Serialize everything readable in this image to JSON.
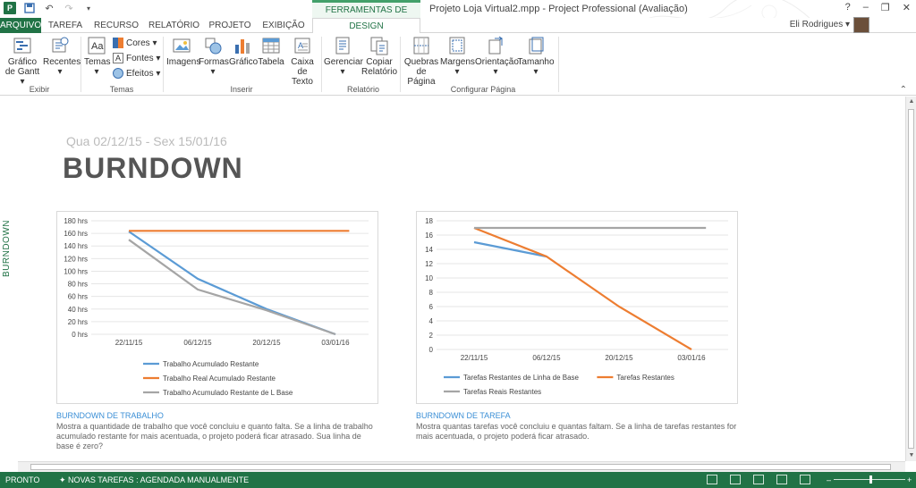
{
  "window": {
    "context_tab_header": "FERRAMENTAS DE RELATÓRIO",
    "title": "Projeto Loja Virtual2.mpp - Project Professional (Avaliação)",
    "help": "?",
    "minimize": "–",
    "restore": "❐",
    "close": "✕"
  },
  "tabs": [
    "ARQUIVO",
    "TAREFA",
    "RECURSO",
    "RELATÓRIO",
    "PROJETO",
    "EXIBIÇÃO",
    "DESIGN"
  ],
  "user": {
    "name": "Eli Rodrigues ▾"
  },
  "ribbon": {
    "groups": [
      "Exibir",
      "Temas",
      "Inserir",
      "Relatório",
      "Configurar Página"
    ],
    "buttons": {
      "gantt": "Gráfico de Gantt ▾",
      "recentes": "Recentes ▾",
      "temas": "Temas ▾",
      "cores": "Cores ▾",
      "fontes": "Fontes ▾",
      "efeitos": "Efeitos ▾",
      "imagens": "Imagens",
      "formas": "Formas ▾",
      "grafico": "Gráfico",
      "tabela": "Tabela",
      "caixa_texto": "Caixa de Texto",
      "gerenciar": "Gerenciar ▾",
      "copiar": "Copiar Relatório",
      "quebras": "Quebras de Página",
      "margens": "Margens ▾",
      "orientacao": "Orientação ▾",
      "tamanho": "Tamanho ▾"
    }
  },
  "report": {
    "side_label": "BURNDOWN",
    "date_range": "Qua 02/12/15 -  Sex 15/01/16",
    "title": "BURNDOWN"
  },
  "charts": {
    "work": {
      "caption": "BURNDOWN DE TRABALHO",
      "description": "Mostra a quantidade de trabalho que você concluiu e quanto falta. Se a linha de trabalho acumulado restante for mais acentuada, o projeto poderá ficar atrasado. Sua linha de base é zero?"
    },
    "tasks": {
      "caption": "BURNDOWN DE TAREFA",
      "description": "Mostra quantas tarefas você concluiu e quantas faltam. Se a linha de tarefas restantes for mais acentuada, o projeto poderá ficar atrasado."
    }
  },
  "chart_data": [
    {
      "type": "line",
      "x": [
        "22/11/15",
        "06/12/15",
        "20/12/15",
        "03/01/16"
      ],
      "ylim": [
        0,
        180
      ],
      "yticks": [
        "0 hrs",
        "20 hrs",
        "40 hrs",
        "60 hrs",
        "80 hrs",
        "100 hrs",
        "120 hrs",
        "140 hrs",
        "160 hrs",
        "180 hrs"
      ],
      "legend_position": "bottom",
      "series": [
        {
          "name": "Trabalho Acumulado Restante",
          "color": "#5b9bd5",
          "points": [
            [
              0,
              163
            ],
            [
              1,
              88
            ],
            [
              2,
              40
            ],
            [
              3,
              0
            ]
          ]
        },
        {
          "name": "Trabalho Real Acumulado Restante",
          "color": "#ed7d31",
          "points": [
            [
              0,
              164
            ],
            [
              3.2,
              164
            ]
          ]
        },
        {
          "name": "Trabalho Acumulado Restante de L Base",
          "color": "#a5a5a5",
          "points": [
            [
              0,
              150
            ],
            [
              1,
              71
            ],
            [
              2,
              38
            ],
            [
              3,
              0
            ]
          ]
        }
      ]
    },
    {
      "type": "line",
      "x": [
        "22/11/15",
        "06/12/15",
        "20/12/15",
        "03/01/16"
      ],
      "ylim": [
        0,
        18
      ],
      "yticks": [
        "0",
        "2",
        "4",
        "6",
        "8",
        "10",
        "12",
        "14",
        "16",
        "18"
      ],
      "legend_position": "bottom",
      "series": [
        {
          "name": "Tarefas Restantes de Linha de Base",
          "color": "#5b9bd5",
          "points": [
            [
              0,
              15
            ],
            [
              1,
              13
            ]
          ]
        },
        {
          "name": "Tarefas Restantes",
          "color": "#ed7d31",
          "points": [
            [
              0,
              17
            ],
            [
              1,
              13
            ],
            [
              2,
              6
            ],
            [
              3,
              0
            ]
          ]
        },
        {
          "name": "Tarefas Reais Restantes",
          "color": "#a5a5a5",
          "points": [
            [
              0,
              17
            ],
            [
              3.2,
              17
            ]
          ]
        }
      ]
    }
  ],
  "status": {
    "ready": "PRONTO",
    "mode": "✦ NOVAS TAREFAS : AGENDADA MANUALMENTE",
    "zoom_minus": "–",
    "zoom_plus": "+"
  }
}
